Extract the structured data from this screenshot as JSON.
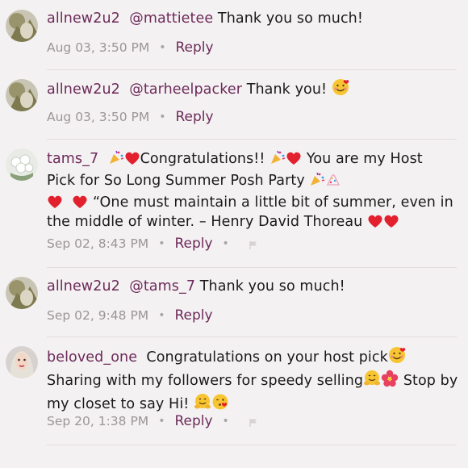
{
  "comments": [
    {
      "username": "allnew2u2",
      "mention": "@mattietee",
      "text": "Thank you so much!",
      "timestamp": "Aug 03, 3:50 PM",
      "reply_label": "Reply"
    },
    {
      "username": "allnew2u2",
      "mention": "@tarheelpacker",
      "text": "Thank you!",
      "timestamp": "Aug 03, 3:50 PM",
      "reply_label": "Reply"
    },
    {
      "username": "tams_7",
      "line1_a": "Congratulations!!",
      "line1_b": "You are my Host",
      "line2": "Pick for So Long Summer  Posh Party",
      "line3": "“One must maintain a little bit of summer, even in",
      "line4": "the middle of winter. – Henry David Thoreau",
      "timestamp": "Sep 02, 8:43 PM",
      "reply_label": "Reply"
    },
    {
      "username": "allnew2u2",
      "mention": "@tams_7",
      "text": "Thank you so much!",
      "timestamp": "Sep 02, 9:48 PM",
      "reply_label": "Reply"
    },
    {
      "username": "beloved_one",
      "line1": "Congratulations on your host pick",
      "line2_a": "Sharing with my followers for speedy selling",
      "line2_b": "Stop by",
      "line3": "my closet to say Hi!",
      "timestamp": "Sep 20, 1:38 PM",
      "reply_label": "Reply"
    }
  ],
  "separator": "•",
  "colors": {
    "brand": "#6c2a59",
    "meta": "#9b9598",
    "background": "#f4f1f2"
  },
  "icons": [
    "smiling-face-with-hearts-icon",
    "party-popper-icon",
    "red-heart-icon",
    "hibiscus-icon",
    "hugging-face-icon",
    "face-blowing-kiss-icon",
    "flag-icon"
  ]
}
